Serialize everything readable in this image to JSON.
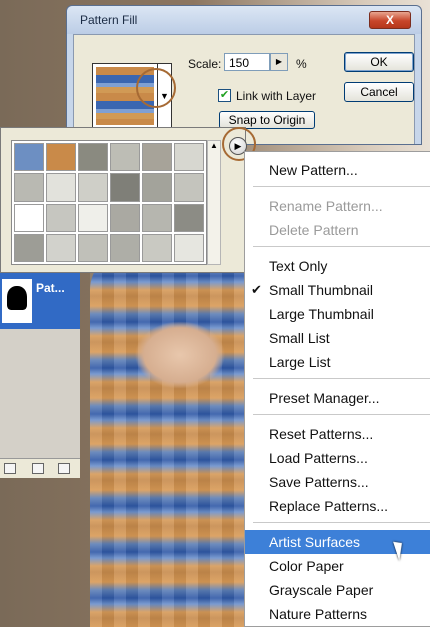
{
  "dialog": {
    "title": "Pattern Fill",
    "close_label": "X",
    "scale_label": "Scale:",
    "scale_value": "150",
    "percent_label": "%",
    "link_with_layer_label": "Link with Layer",
    "link_with_layer_checked": true,
    "snap_to_origin_label": "Snap to Origin",
    "ok_label": "OK",
    "cancel_label": "Cancel"
  },
  "layers": {
    "layer_name": "Pat..."
  },
  "menu": {
    "items": [
      {
        "label": "New Pattern...",
        "enabled": true
      },
      {
        "label": "Rename Pattern...",
        "enabled": false
      },
      {
        "label": "Delete Pattern",
        "enabled": false
      },
      {
        "label": "Text Only",
        "enabled": true
      },
      {
        "label": "Small Thumbnail",
        "enabled": true,
        "checked": true
      },
      {
        "label": "Large Thumbnail",
        "enabled": true
      },
      {
        "label": "Small List",
        "enabled": true
      },
      {
        "label": "Large List",
        "enabled": true
      },
      {
        "label": "Preset Manager...",
        "enabled": true
      },
      {
        "label": "Reset Patterns...",
        "enabled": true
      },
      {
        "label": "Load Patterns...",
        "enabled": true
      },
      {
        "label": "Save Patterns...",
        "enabled": true
      },
      {
        "label": "Replace Patterns...",
        "enabled": true
      },
      {
        "label": "Artist Surfaces",
        "enabled": true,
        "highlighted": true
      },
      {
        "label": "Color Paper",
        "enabled": true
      },
      {
        "label": "Grayscale Paper",
        "enabled": true
      },
      {
        "label": "Nature Patterns",
        "enabled": true
      }
    ]
  },
  "colors": {
    "highlight": "#3d80d8",
    "annotation": "#a66a34",
    "disabled_text": "#9a9a9a"
  },
  "pattern_tiles": [
    "#6d8fc2",
    "#c98a49",
    "#8a8a80",
    "#bdbdb5",
    "#a7a399",
    "#d7d7d0",
    "#b9b9b2",
    "#e2e2dc",
    "#cfcfc8",
    "#7f7f78",
    "#a3a39b",
    "#c4c4bd",
    "#ffffff",
    "#c6c6c0",
    "#efefea",
    "#aaa9a2",
    "#b6b6af",
    "#8c8c85",
    "#9d9d96",
    "#d2d2cc",
    "#c0c0b9",
    "#aeaea7",
    "#c9c9c2",
    "#e6e6e0"
  ]
}
